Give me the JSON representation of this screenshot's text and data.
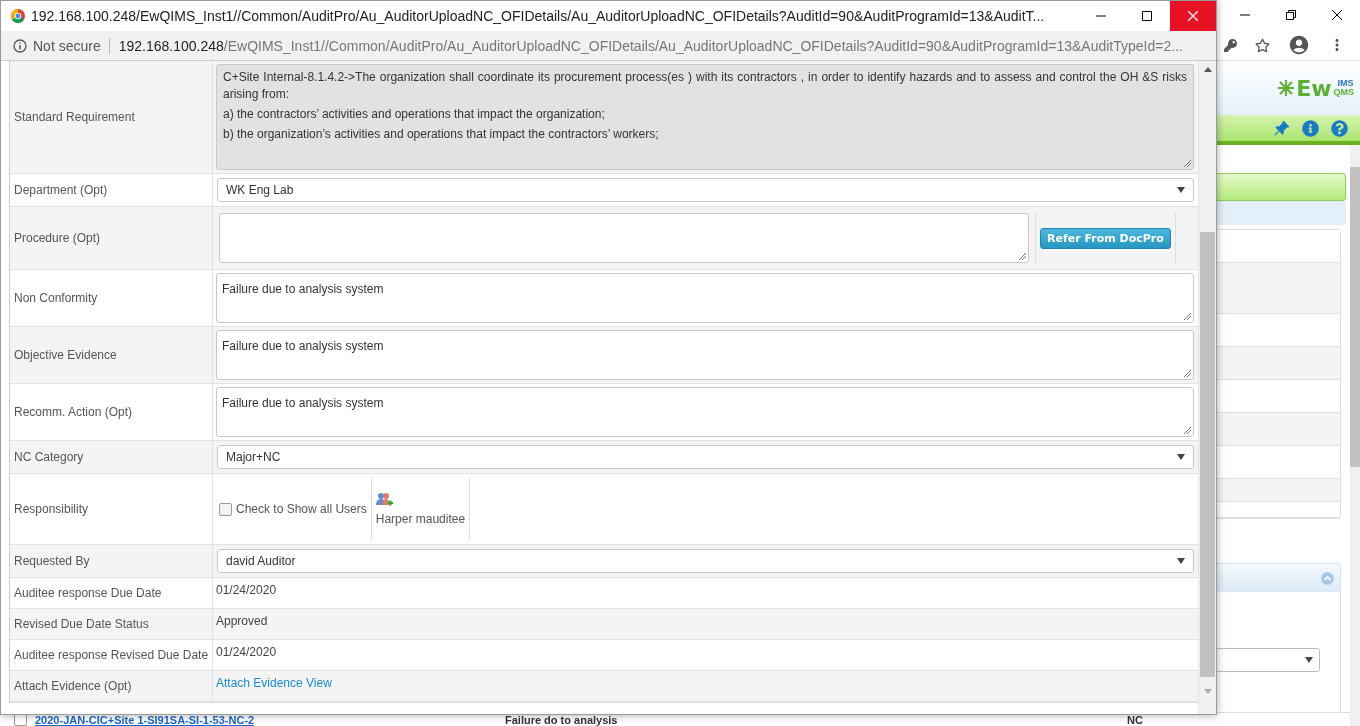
{
  "popup": {
    "title": "192.168.100.248/EwQIMS_Inst1//Common/AuditPro/Au_AuditorUploadNC_OFIDetails/Au_AuditorUploadNC_OFIDetails?AuditId=90&AuditProgramId=13&AuditT...",
    "address": {
      "security": "Not secure",
      "host": "192.168.100.248",
      "path": "/EwQIMS_Inst1//Common/AuditPro/Au_AuditorUploadNC_OFIDetails/Au_AuditorUploadNC_OFIDetails?AuditId=90&AuditProgramId=13&AuditTypeId=2..."
    },
    "form": {
      "rows": [
        {
          "kind": "readonly",
          "label": "Standard Requirement",
          "lines": [
            "C+Site Internal-8.1.4.2->The organization shall coordinate its procurement process(es ) with its contractors , in order to identify hazards and to assess and control the OH &S risks arising from:",
            "a) the contractors’ activities and operations that impact the organization;",
            "b) the organization’s activities and operations that impact the contractors’ workers;"
          ]
        },
        {
          "kind": "select",
          "label": "Department (Opt)",
          "value": "WK Eng Lab"
        },
        {
          "kind": "textarea_button",
          "label": "Procedure (Opt)",
          "button": "Refer From DocPro"
        },
        {
          "kind": "textarea",
          "label": "Non Conformity",
          "value": "Failure due to analysis system"
        },
        {
          "kind": "textarea",
          "label": "Objective Evidence",
          "value": "Failure due to analysis system"
        },
        {
          "kind": "textarea",
          "label": "Recomm. Action (Opt)",
          "value": "Failure due to analysis system"
        },
        {
          "kind": "select",
          "label": "NC Category",
          "value": "Major+NC"
        },
        {
          "kind": "responsibility",
          "label": "Responsibility",
          "checkbox": {
            "label": "Check to Show all Users",
            "checked": false
          },
          "user": "Harper mauditee"
        },
        {
          "kind": "select",
          "label": "Requested By",
          "value": "david Auditor"
        },
        {
          "kind": "text",
          "label": "Auditee response Due Date",
          "value": "01/24/2020"
        },
        {
          "kind": "text",
          "label": "Revised Due Date Status",
          "value": "Approved"
        },
        {
          "kind": "text",
          "label": "Auditee response Revised Due Date",
          "value": "01/24/2020"
        },
        {
          "kind": "link",
          "label": "Attach Evidence (Opt)",
          "value": "Attach Evidence View"
        }
      ]
    }
  },
  "background": {
    "logo": {
      "main": "Ew",
      "top": "IMS",
      "bottom": "QMS"
    },
    "table_row": {
      "checked": false,
      "link": "2020-JAN-CIC+Site 1-SI91SA-SI-1-53-NC-2",
      "description": "Failure do to analysis",
      "type": "NC"
    }
  }
}
